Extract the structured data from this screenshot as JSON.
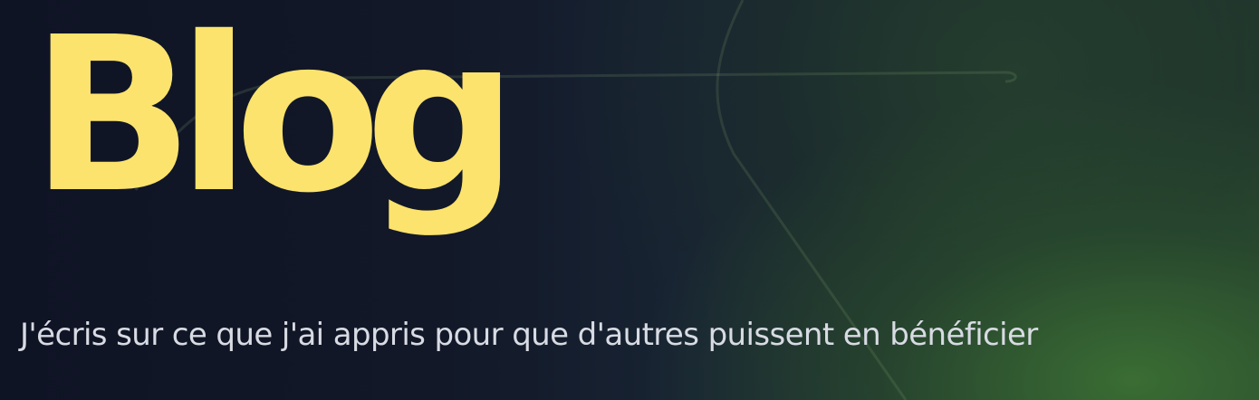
{
  "hero": {
    "title": "Blog",
    "subtitle": "J'écris sur ce que j'ai appris pour que d'autres puissent en bénéficier"
  },
  "colors": {
    "title": "#fce36d",
    "subtitle": "#d8dbe3",
    "background_dark": "#121726",
    "background_green": "#3e7634"
  }
}
